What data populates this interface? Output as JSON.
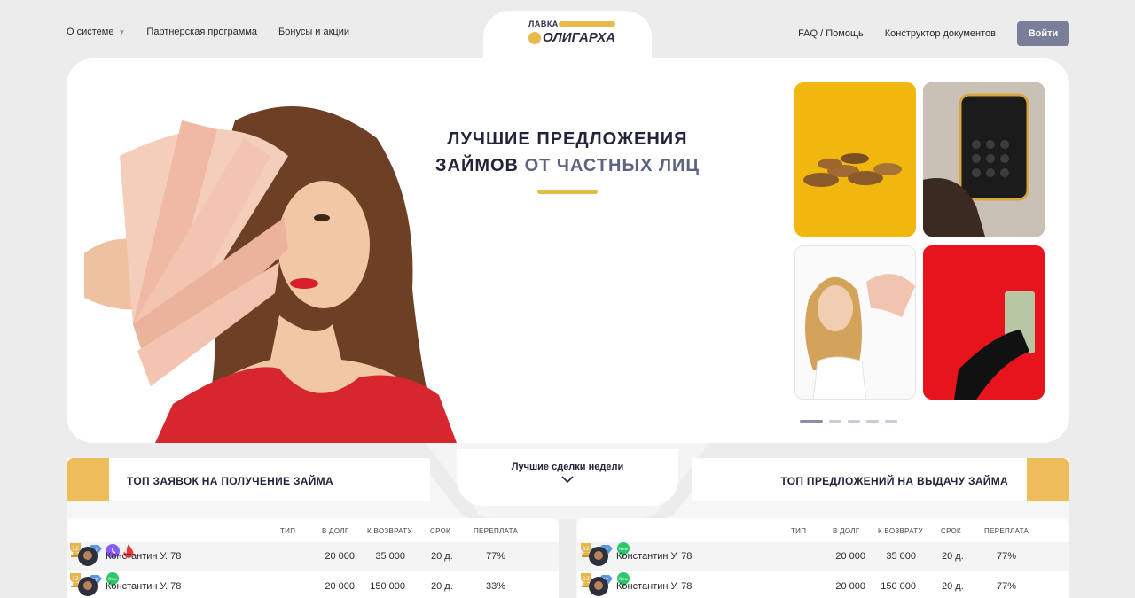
{
  "nav": {
    "left": [
      {
        "label": "О системе",
        "caret": "▼"
      },
      {
        "label": "Партнерская программа"
      },
      {
        "label": "Бонусы и акции"
      }
    ],
    "right": [
      {
        "label": "FAQ / Помощь"
      },
      {
        "label": "Конструктор документов"
      }
    ],
    "login_label": "Войти"
  },
  "logo": {
    "line1": "ЛАВКА",
    "line2": "ОЛИГАРХА"
  },
  "hero": {
    "title_line1": "ЛУЧШИЕ ПРЕДЛОЖЕНИЯ",
    "title_line2_plain": "ЗАЙМОВ ",
    "title_line2_accent": "ОТ ЧАСТНЫХ ЛИЦ",
    "slides": 5,
    "active_slide": 1
  },
  "week": {
    "label": "Лучшие сделки недели"
  },
  "left_panel": {
    "title": "ТОП ЗАЯВОК НА ПОЛУЧЕНИЕ ЗАЙМА",
    "headers": {
      "type": "ТИП",
      "debt": "В ДОЛГ",
      "return": "К ВОЗВРАТУ",
      "term": "СРОК",
      "overpay": "ПЕРЕПЛАТА"
    },
    "rows": [
      {
        "name": "Константин У. 78",
        "level": "12",
        "rank": "17",
        "type_icon": "clock-icon",
        "debt": "20 000",
        "return": "35 000",
        "term": "20 д.",
        "overpay": "77%",
        "status_icon": "fire-icon"
      },
      {
        "name": "Константин У. 78",
        "level": "12",
        "rank": "17",
        "type_icon": "",
        "debt": "20 000",
        "return": "150 000",
        "term": "20 д.",
        "overpay": "33%",
        "status_icon": "new-icon"
      }
    ]
  },
  "right_panel": {
    "title": "ТОП ПРЕДЛОЖЕНИЙ НА ВЫДАЧУ ЗАЙМА",
    "headers": {
      "type": "ТИП",
      "debt": "В ДОЛГ",
      "return": "К ВОЗВРАТУ",
      "term": "СРОК",
      "overpay": "ПЕРЕПЛАТА"
    },
    "rows": [
      {
        "name": "Константин У. 78",
        "level": "12",
        "rank": "17",
        "debt": "20 000",
        "return": "35 000",
        "term": "20 д.",
        "overpay": "77%",
        "status_icon": "new-icon"
      },
      {
        "name": "Константин У. 78",
        "level": "12",
        "rank": "17",
        "debt": "20 000",
        "return": "150 000",
        "term": "20 д.",
        "overpay": "77%",
        "status_icon": "new-icon"
      }
    ]
  },
  "badges": {
    "new": "New"
  },
  "colors": {
    "accent": "#e9b94c",
    "button": "#7a7e98",
    "title": "#22243a",
    "title_accent": "#5d6383",
    "background": "#ececec"
  }
}
